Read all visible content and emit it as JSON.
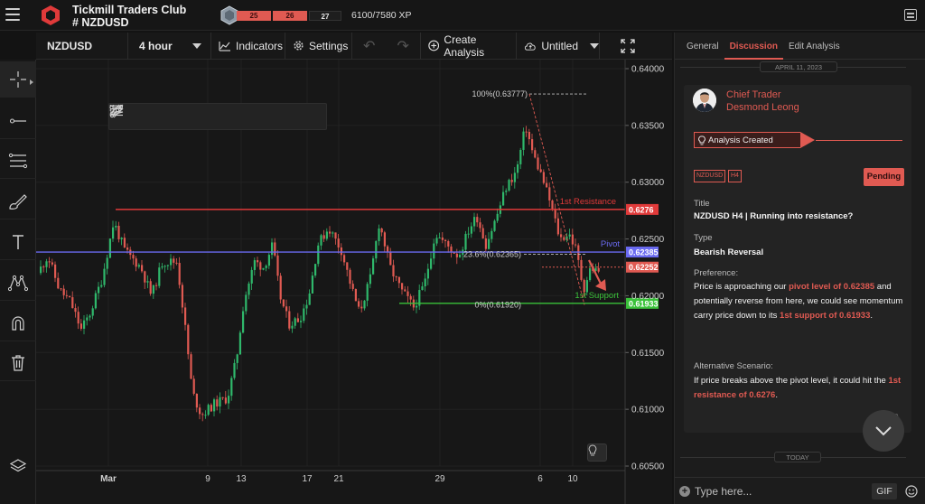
{
  "header": {
    "club_title": "Tickmill Traders Club",
    "channel": "# NZDUSD",
    "level_segments": [
      "25",
      "26",
      "27"
    ],
    "xp_text": "6100/7580 XP"
  },
  "toolbar": {
    "symbol": "NZDUSD",
    "interval": "4 hour",
    "indicators_label": "Indicators",
    "settings_label": "Settings",
    "create_analysis_label": "Create Analysis",
    "layout_label": "Untitled"
  },
  "chart": {
    "y_axis_labels": [
      "0.64000",
      "0.63500",
      "0.63000",
      "0.62500",
      "0.62000",
      "0.61500",
      "0.61000",
      "0.60500"
    ],
    "x_axis_labels": [
      "Mar",
      "9",
      "13",
      "17",
      "21",
      "29",
      "6",
      "10"
    ],
    "levels": {
      "resistance": {
        "label": "1st Resistance",
        "price_tag": "0.6276",
        "color": "#e03a3a"
      },
      "pivot": {
        "label": "Pivot",
        "price_tag": "0.62385",
        "color": "#6a6af0"
      },
      "support": {
        "label": "1st Support",
        "price_tag": "0.61933",
        "color": "#3ac23a"
      },
      "current": {
        "price_tag": "0.62252",
        "color": "#e05a52"
      }
    },
    "fib": {
      "top": "100%(0.63777)",
      "mid": "23.6%(0.62365)",
      "bottom": "0%(0.61920)"
    },
    "colors": {
      "up": "#2fb86b",
      "down": "#e05a52"
    }
  },
  "panel": {
    "tabs": [
      "General",
      "Discussion",
      "Edit Analysis"
    ],
    "active_tab": "Discussion",
    "date_separator": "APRIL 11, 2023",
    "author_role": "Chief Trader",
    "author_name": "Desmond Leong",
    "ribbon": "Analysis Created",
    "tags": [
      "NZDUSD",
      "H4"
    ],
    "status": "Pending",
    "title_label": "Title",
    "title_value": "NZDUSD H4 | Running into resistance?",
    "type_label": "Type",
    "type_value": "Bearish Reversal",
    "preference_label": "Preference:",
    "preference_1": "Price is approaching our ",
    "preference_hl1": "pivot level of 0.62385",
    "preference_2": " and potentially reverse from here, we could see momentum carry price down to its ",
    "preference_hl2": "1st support of 0.61933",
    "preference_3": ".",
    "alt_label": "Alternative Scenario:",
    "alt_1": "If price breaks above the pivot level, it could hit the ",
    "alt_hl": "1st resistance of 0.6276",
    "alt_2": ".",
    "badge_count": "0",
    "today_separator": "TODAY",
    "compose_placeholder": "Type here...",
    "gif_label": "GIF"
  }
}
